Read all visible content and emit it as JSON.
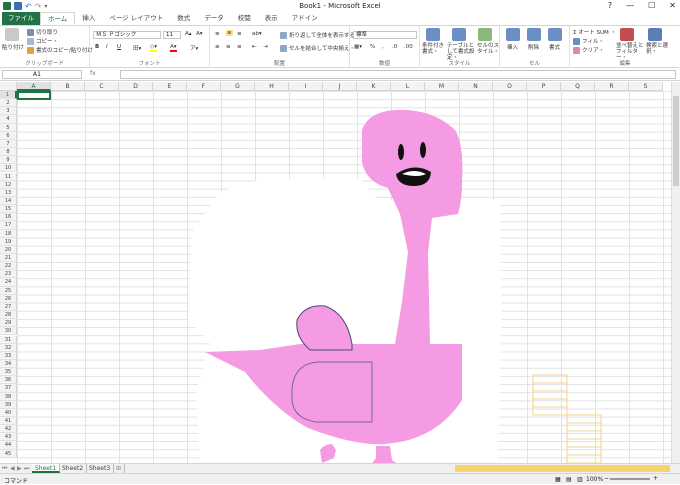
{
  "window": {
    "title": "Book1 - Microsoft Excel"
  },
  "tabs": [
    {
      "label": "ファイル"
    },
    {
      "label": "ホーム"
    },
    {
      "label": "挿入"
    },
    {
      "label": "ページ レイアウト"
    },
    {
      "label": "数式"
    },
    {
      "label": "データ"
    },
    {
      "label": "校閲"
    },
    {
      "label": "表示"
    },
    {
      "label": "アドイン"
    }
  ],
  "ribbon": {
    "clipboard": {
      "paste": "貼り付け",
      "cut": "切り取り",
      "copy": "コピー・",
      "format_painter": "書式のコピー/貼り付け",
      "label": "クリップボード"
    },
    "font": {
      "name": "ＭＳ Ｐゴシック",
      "size": "11",
      "label": "フォント",
      "bold": "B",
      "italic": "I",
      "underline": "U"
    },
    "alignment": {
      "wrap": "折り返して全体を表示する",
      "merge": "セルを結合して中央揃え・",
      "label": "配置"
    },
    "number": {
      "format": "標準",
      "label": "数値"
    },
    "styles": {
      "conditional": "条件付き書式・",
      "table": "テーブルとして書式設定・",
      "cell": "セルのスタイル・",
      "label": "スタイル"
    },
    "cells": {
      "insert": "挿入",
      "delete": "削除",
      "format": "書式",
      "label": "セル"
    },
    "editing": {
      "autosum": "オート SUM ・",
      "fill": "フィル・",
      "clear": "クリア・",
      "sort": "並べ替えとフィルター・",
      "find": "検索と選択・",
      "label": "編集"
    }
  },
  "formula_bar": {
    "name_box": "A1",
    "fx": "fx"
  },
  "columns": [
    "A",
    "B",
    "C",
    "D",
    "E",
    "F",
    "G",
    "H",
    "I",
    "J",
    "K",
    "L",
    "M",
    "N",
    "O",
    "P",
    "Q",
    "R",
    "S"
  ],
  "rows": [
    "1",
    "2",
    "3",
    "4",
    "5",
    "6",
    "7",
    "8",
    "9",
    "10",
    "11",
    "12",
    "13",
    "14",
    "15",
    "16",
    "17",
    "18",
    "19",
    "20",
    "21",
    "22",
    "23",
    "24",
    "25",
    "26",
    "27",
    "28",
    "29",
    "30",
    "31",
    "32",
    "33",
    "34",
    "35",
    "36",
    "37",
    "38",
    "39",
    "40",
    "41",
    "42",
    "43",
    "44",
    "45"
  ],
  "sheets": [
    "Sheet1",
    "Sheet2",
    "Sheet3"
  ],
  "status": {
    "mode": "コマンド",
    "zoom": "100%"
  },
  "colors": {
    "accent": "#217346",
    "flamingo": "#f49be3",
    "highlight": "#ffc000"
  }
}
